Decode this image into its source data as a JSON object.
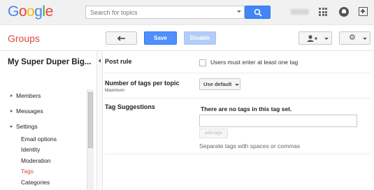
{
  "topbar": {
    "logo": "Google",
    "search_placeholder": "Search for topics",
    "icons": [
      "search-icon",
      "apps-grid-icon",
      "notifications-icon",
      "share-icon"
    ]
  },
  "toolbar": {
    "app_title": "Groups",
    "save_label": "Save",
    "disable_label": "Disable",
    "back_icon": "back-arrow-icon",
    "members_icon": "add-person-icon",
    "settings_icon": "gear-icon"
  },
  "sidebar": {
    "group_name": "My Super Duper Big...",
    "items": [
      {
        "label": "Members",
        "expanded": false
      },
      {
        "label": "Messages",
        "expanded": false
      },
      {
        "label": "Settings",
        "expanded": true
      }
    ],
    "settings_subitems": [
      {
        "label": "Email options",
        "active": false
      },
      {
        "label": "Identity",
        "active": false
      },
      {
        "label": "Moderation",
        "active": false
      },
      {
        "label": "Tags",
        "active": true
      },
      {
        "label": "Categories",
        "active": false
      }
    ]
  },
  "settings": {
    "post_rule": {
      "label": "Post rule",
      "checkbox_label": "Users must enter at least one tag",
      "checked": false
    },
    "tags_per_topic": {
      "label": "Number of tags per topic",
      "sublabel": "Maximum",
      "value": "Use default"
    },
    "tag_suggestions": {
      "label": "Tag Suggestions",
      "empty_message": "There are no tags in this tag set.",
      "input_value": "",
      "add_button": "add tags",
      "hint": "Separate tags with spaces or commas"
    }
  },
  "colors": {
    "brand_red": "#dd4b39",
    "primary_blue": "#4d90fe",
    "search_blue": "#4285f4",
    "disabled_blue": "#b3cdf8"
  }
}
